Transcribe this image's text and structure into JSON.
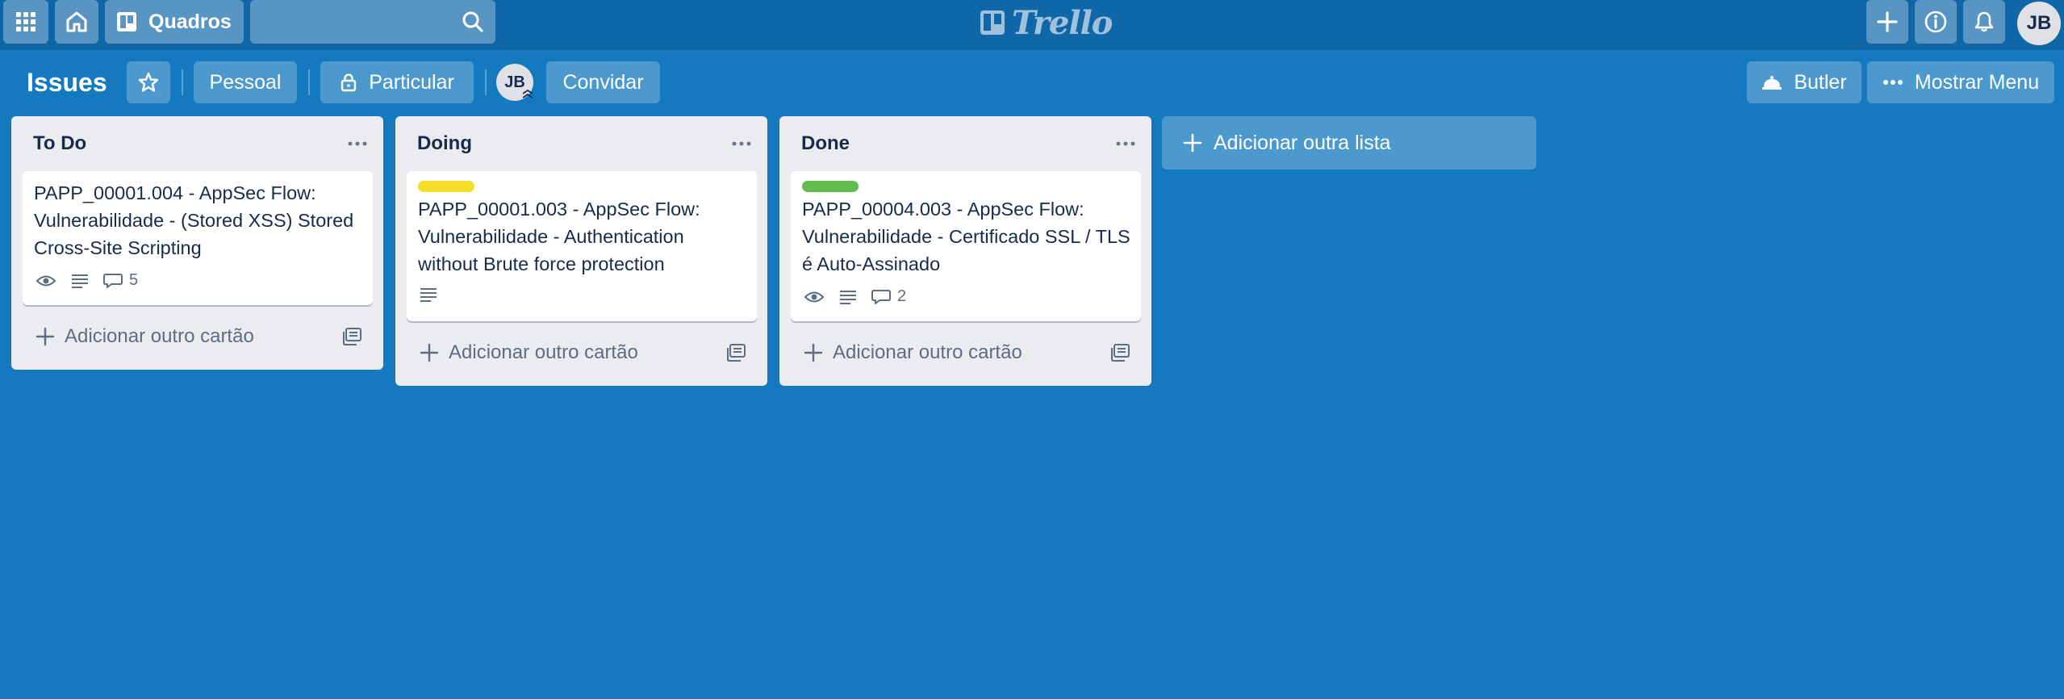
{
  "nav": {
    "boards_label": "Quadros",
    "search_value": "",
    "logo_text": "Trello",
    "user_initials": "JB"
  },
  "board": {
    "title": "Issues",
    "team_label": "Pessoal",
    "visibility_label": "Particular",
    "member_initials": "JB",
    "invite_label": "Convidar",
    "butler_label": "Butler",
    "menu_label": "Mostrar Menu"
  },
  "lists": [
    {
      "title": "To Do",
      "add_card_label": "Adicionar outro cartão",
      "cards": [
        {
          "label_color": "",
          "title": "PAPP_00001.004 - AppSec Flow: Vulnerabilidade - (Stored XSS) Stored Cross-Site Scripting",
          "watching": true,
          "has_description": true,
          "comments": "5"
        }
      ]
    },
    {
      "title": "Doing",
      "add_card_label": "Adicionar outro cartão",
      "cards": [
        {
          "label_color": "#f5dd29",
          "title": "PAPP_00001.003 - AppSec Flow: Vulnerabilidade - Authentication without Brute force protection",
          "watching": false,
          "has_description": true,
          "comments": ""
        }
      ]
    },
    {
      "title": "Done",
      "add_card_label": "Adicionar outro cartão",
      "cards": [
        {
          "label_color": "#61bd4f",
          "title": "PAPP_00004.003 - AppSec Flow: Vulnerabilidade - Certificado SSL / TLS é Auto-Assinado",
          "watching": true,
          "has_description": true,
          "comments": "2"
        }
      ]
    }
  ],
  "add_list_label": "Adicionar outra lista",
  "colors": {
    "board_bg": "#1479bf",
    "nav_bg": "#1067a8",
    "list_bg": "#ebecf0",
    "text_dark": "#172b4d",
    "text_muted": "#5e6c84"
  }
}
